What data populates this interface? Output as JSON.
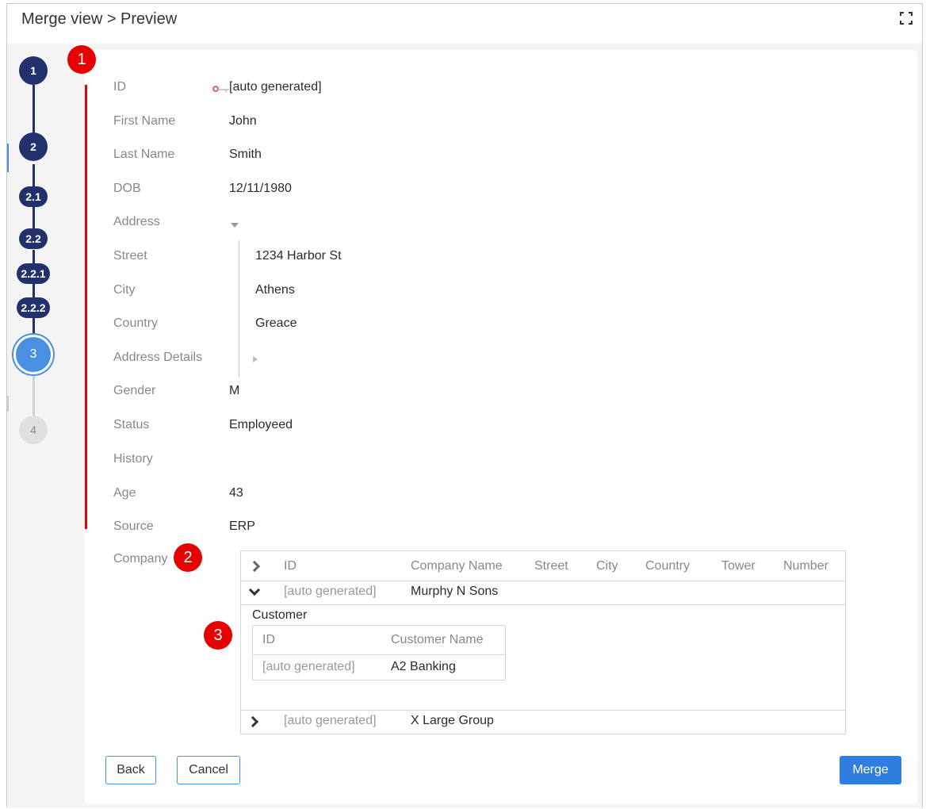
{
  "window": {
    "title": "Merge view > Preview"
  },
  "steps": [
    {
      "label": "1",
      "state": "completed"
    },
    {
      "label": "2",
      "state": "completed"
    },
    {
      "label": "2.1",
      "state": "completed"
    },
    {
      "label": "2.2",
      "state": "completed"
    },
    {
      "label": "2.2.1",
      "state": "completed"
    },
    {
      "label": "2.2.2",
      "state": "completed"
    },
    {
      "label": "3",
      "state": "active"
    },
    {
      "label": "4",
      "state": "inactive"
    }
  ],
  "badges": [
    "1",
    "2",
    "3"
  ],
  "fields": [
    {
      "label": "ID",
      "value": "[auto generated]",
      "icon": "key-icon"
    },
    {
      "label": "First Name",
      "value": "John"
    },
    {
      "label": "Last Name",
      "value": "Smith"
    },
    {
      "label": "DOB",
      "value": "12/11/1980"
    },
    {
      "label": "Address",
      "value": ""
    },
    {
      "label": "Street",
      "value": "1234 Harbor St"
    },
    {
      "label": "City",
      "value": "Athens"
    },
    {
      "label": "Country",
      "value": "Greace"
    },
    {
      "label": "Address Details",
      "value": ""
    },
    {
      "label": "Gender",
      "value": "M"
    },
    {
      "label": "Status",
      "value": "Employeed"
    },
    {
      "label": "History",
      "value": ""
    },
    {
      "label": "Age",
      "value": "43"
    },
    {
      "label": "Source",
      "value": "ERP"
    },
    {
      "label": "Company",
      "value": ""
    }
  ],
  "company_table": {
    "columns": [
      "ID",
      "Company Name",
      "Street",
      "City",
      "Country",
      "Tower",
      "Number"
    ],
    "rows": [
      {
        "id": "[auto generated]",
        "name": "Murphy N Sons",
        "expanded": true
      },
      {
        "id": "[auto generated]",
        "name": "X Large Group",
        "expanded": false
      }
    ],
    "nested_title": "Customer",
    "nested_columns": [
      "ID",
      "Customer Name"
    ],
    "nested_rows": [
      {
        "id": "[auto generated]",
        "name": "A2 Banking"
      }
    ]
  },
  "buttons": {
    "back": "Back",
    "cancel": "Cancel",
    "merge": "Merge"
  },
  "colors": {
    "step_completed": "#22306b",
    "step_active": "#4a90e2",
    "badge": "#e60000",
    "primary": "#2f7de1"
  }
}
